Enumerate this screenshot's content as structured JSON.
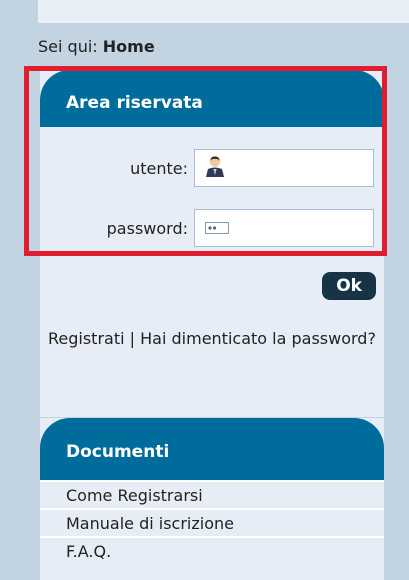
{
  "breadcrumb": {
    "prefix": "Sei qui:",
    "current": "Home"
  },
  "login_panel": {
    "title": "Area riservata",
    "user_label": "utente:",
    "user_value": "",
    "password_label": "password:",
    "password_value": "",
    "ok_label": "Ok",
    "register_link": "Registrati",
    "separator": "|",
    "forgot_link": "Hai dimenticato la password?"
  },
  "documents_panel": {
    "title": "Documenti",
    "items": [
      "Come Registrarsi",
      "Manuale di iscrizione",
      "F.A.Q."
    ]
  },
  "colors": {
    "panel_header": "#006c9c",
    "panel_body": "#e7edf7",
    "page_background": "#c2d3e1",
    "ok_button": "#173446",
    "highlight": "#e01e2e"
  },
  "icons": {
    "user_field": "user-icon",
    "password_field": "password-icon"
  }
}
